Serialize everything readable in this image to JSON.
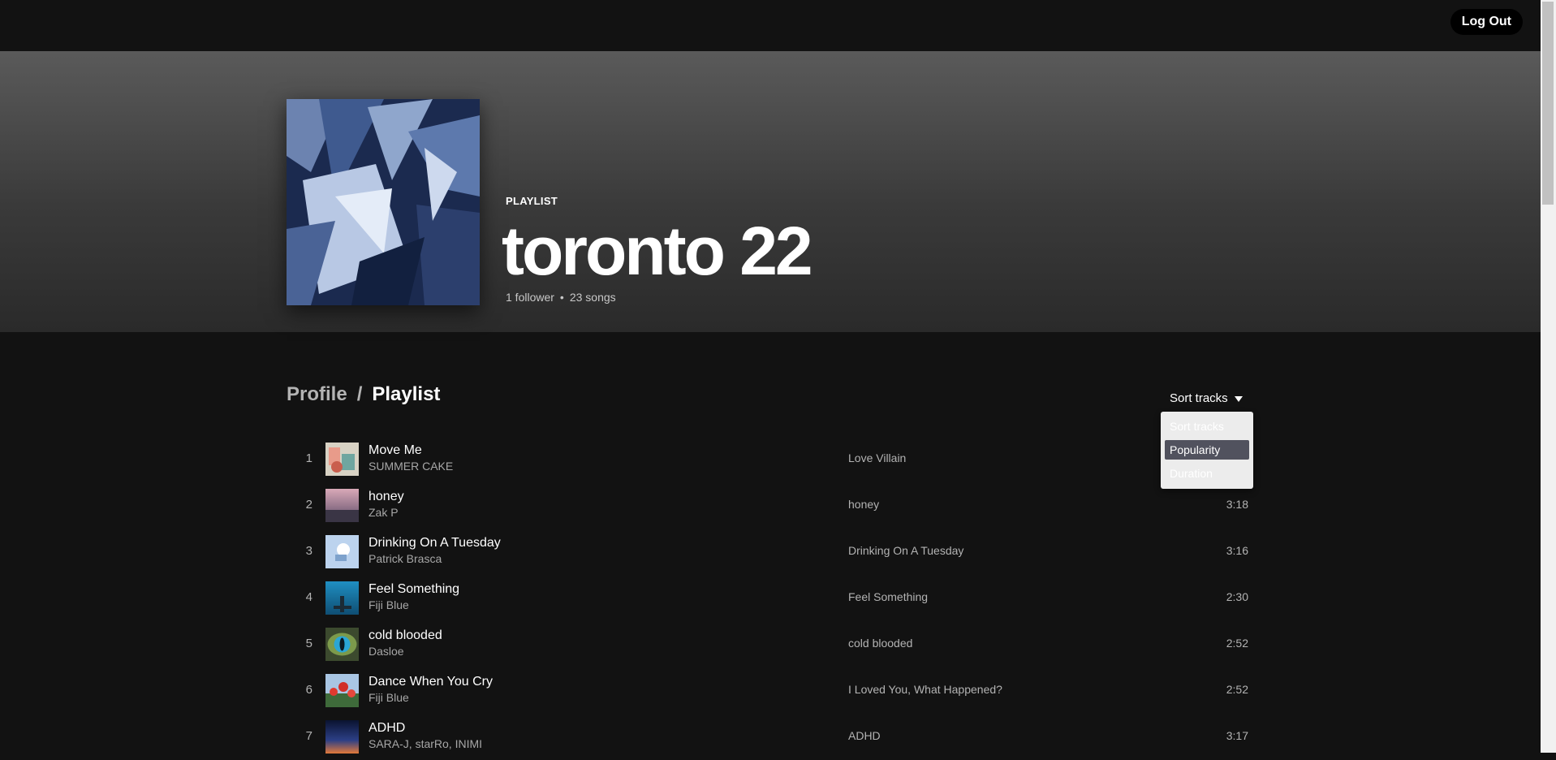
{
  "header": {
    "logout_label": "Log Out"
  },
  "playlist": {
    "type_label": "PLAYLIST",
    "title": "toronto 22",
    "followers": "1 follower",
    "meta_separator": "•",
    "songs": "23 songs"
  },
  "breadcrumb": {
    "profile": "Profile",
    "separator": "/",
    "current": "Playlist"
  },
  "sort": {
    "label": "Sort tracks",
    "options": [
      "Sort tracks",
      "Popularity",
      "Duration"
    ],
    "selected": "Popularity"
  },
  "tracks": [
    {
      "num": "1",
      "title": "Move Me",
      "artist": "SUMMER CAKE",
      "album": "Love Villain",
      "duration": ""
    },
    {
      "num": "2",
      "title": "honey",
      "artist": "Zak P",
      "album": "honey",
      "duration": "3:18"
    },
    {
      "num": "3",
      "title": "Drinking On A Tuesday",
      "artist": "Patrick Brasca",
      "album": "Drinking On A Tuesday",
      "duration": "3:16"
    },
    {
      "num": "4",
      "title": "Feel Something",
      "artist": "Fiji Blue",
      "album": "Feel Something",
      "duration": "2:30"
    },
    {
      "num": "5",
      "title": "cold blooded",
      "artist": "Dasloe",
      "album": "cold blooded",
      "duration": "2:52"
    },
    {
      "num": "6",
      "title": "Dance When You Cry",
      "artist": "Fiji Blue",
      "album": "I Loved You, What Happened?",
      "duration": "2:52"
    },
    {
      "num": "7",
      "title": "ADHD",
      "artist": "SARA-J, starRo, INIMI",
      "album": "ADHD",
      "duration": "3:17"
    }
  ],
  "colors": {
    "background": "#121212",
    "hero_top": "#5a5a5a",
    "dropdown_bg": "#ececec",
    "dropdown_selected": "#51525e",
    "cover_base": "#1e2c52"
  }
}
